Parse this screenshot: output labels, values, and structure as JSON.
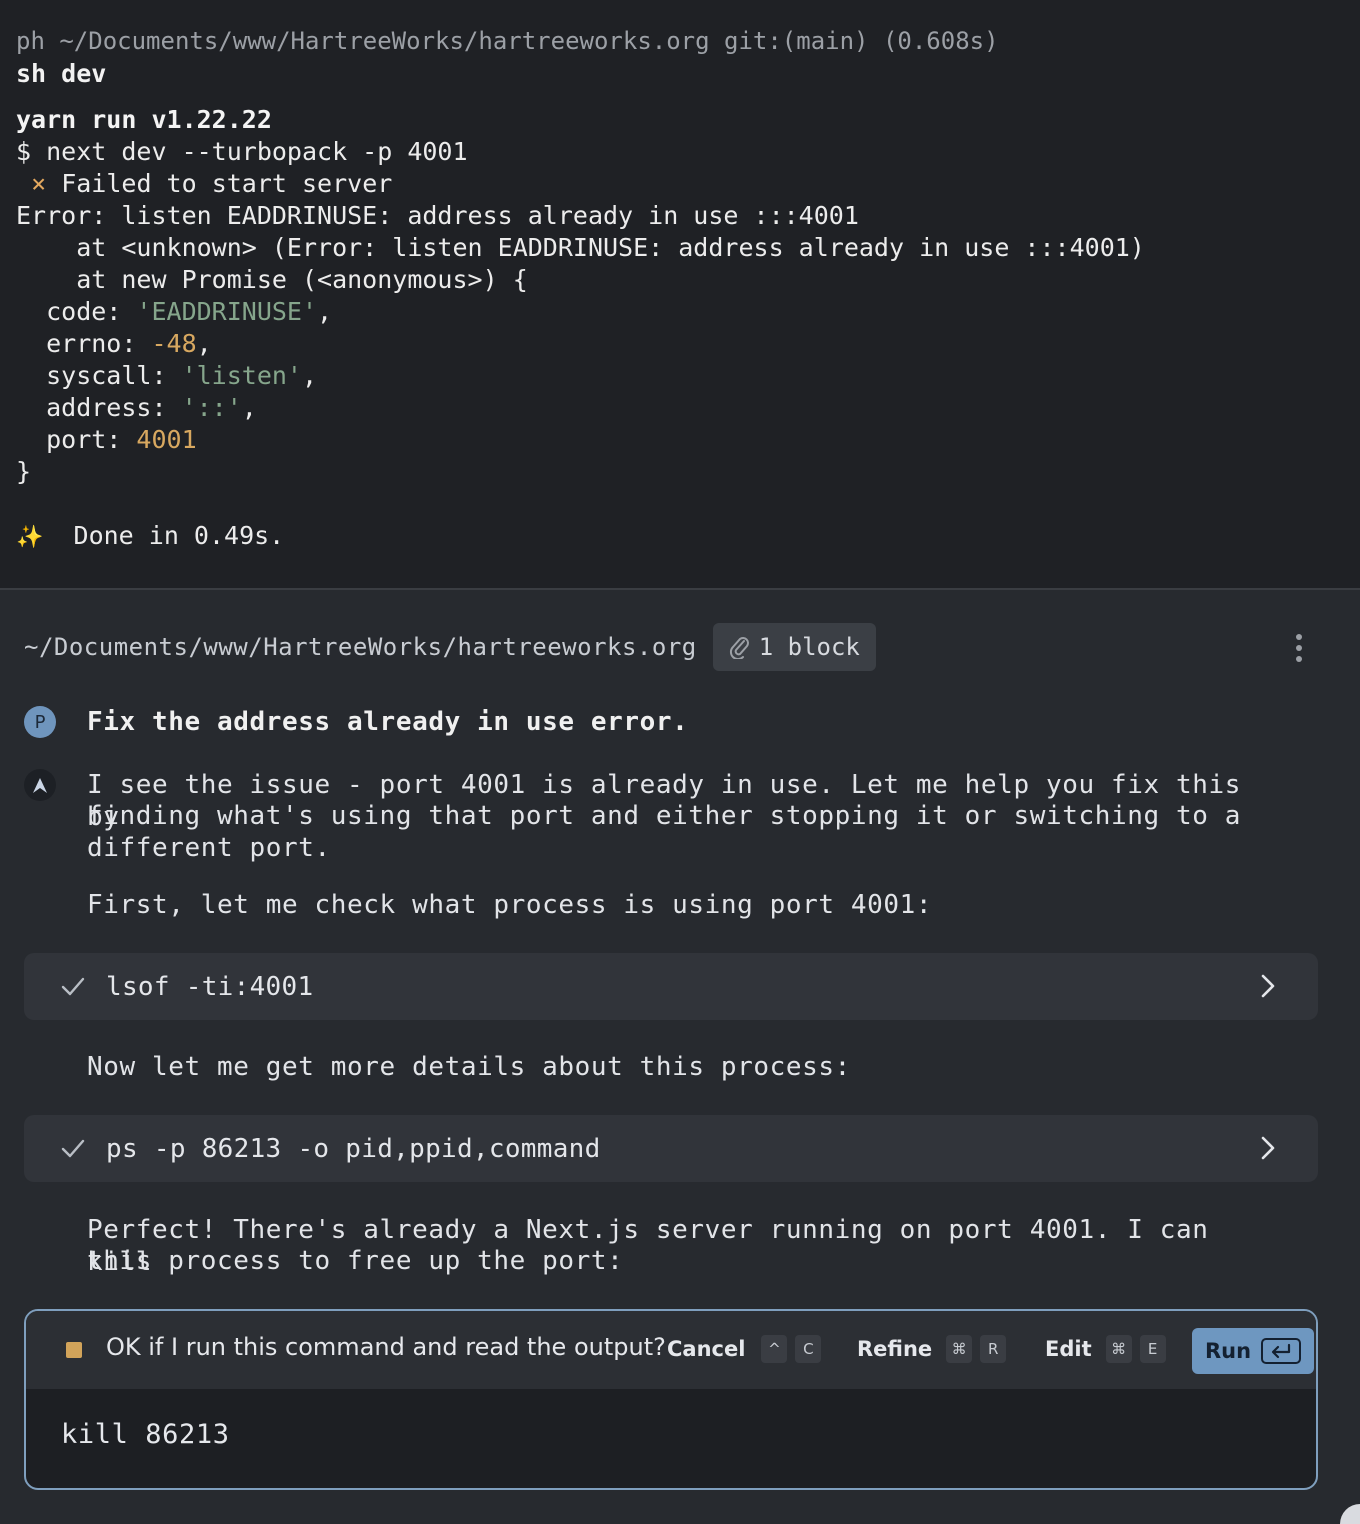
{
  "terminal": {
    "prompt": "ph ~/Documents/www/HartreeWorks/hartreeworks.org git:(main) (0.608s)",
    "command": "sh dev",
    "output": {
      "yarn_header": "yarn run v1.22.22",
      "run_line": "$ next dev --turbopack -p 4001",
      "fail_mark": "×",
      "fail_text": "Failed to start server",
      "error_line": "Error: listen EADDRINUSE: address already in use :::4001",
      "stack_1": "    at <unknown> (Error: listen EADDRINUSE: address already in use :::4001)",
      "stack_2": "    at new Promise (<anonymous>) {",
      "code_key": "  code: ",
      "code_val": "'EADDRINUSE'",
      "errno_key": "  errno: ",
      "errno_val": "-48",
      "syscall_key": "  syscall: ",
      "syscall_val": "'listen'",
      "address_key": "  address: ",
      "address_val": "'::'",
      "port_key": "  port: ",
      "port_val": "4001",
      "close_brace": "}",
      "sparkle": "✨",
      "done_text": "Done in 0.49s."
    }
  },
  "session": {
    "cwd": "~/Documents/www/HartreeWorks/hartreeworks.org",
    "attachment_label": "1 block",
    "user_avatar": "P",
    "user_message": "Fix the address already in use error.",
    "agent_avatar": "A",
    "agent_msg_1_line_1": "I see the issue - port 4001 is already in use. Let me help you fix this by",
    "agent_msg_1_line_2": "finding what's using that port and either stopping it or switching to a",
    "agent_msg_1_line_3": "different port.",
    "agent_msg_2": "First, let me check what process is using port 4001:",
    "cmd_1": "lsof -ti:4001",
    "agent_msg_3": "Now let me get more details about this process:",
    "cmd_2": "ps -p 86213 -o pid,ppid,command",
    "agent_msg_4_line_1": "Perfect! There's already a Next.js server running on port 4001. I can kill",
    "agent_msg_4_line_2": "this process to free up the port:"
  },
  "permission": {
    "question": "OK if I run this command and read the output?",
    "cancel_label": "Cancel",
    "cancel_key_1": "^",
    "cancel_key_2": "C",
    "refine_label": "Refine",
    "refine_key_1": "⌘",
    "refine_key_2": "R",
    "edit_label": "Edit",
    "edit_key_1": "⌘",
    "edit_key_2": "E",
    "run_label": "Run",
    "command": "kill 86213"
  },
  "colors": {
    "accent": "#6e97c0",
    "pending_square": "#d2a45a",
    "string": "#86a68c",
    "number": "#d8a860"
  }
}
